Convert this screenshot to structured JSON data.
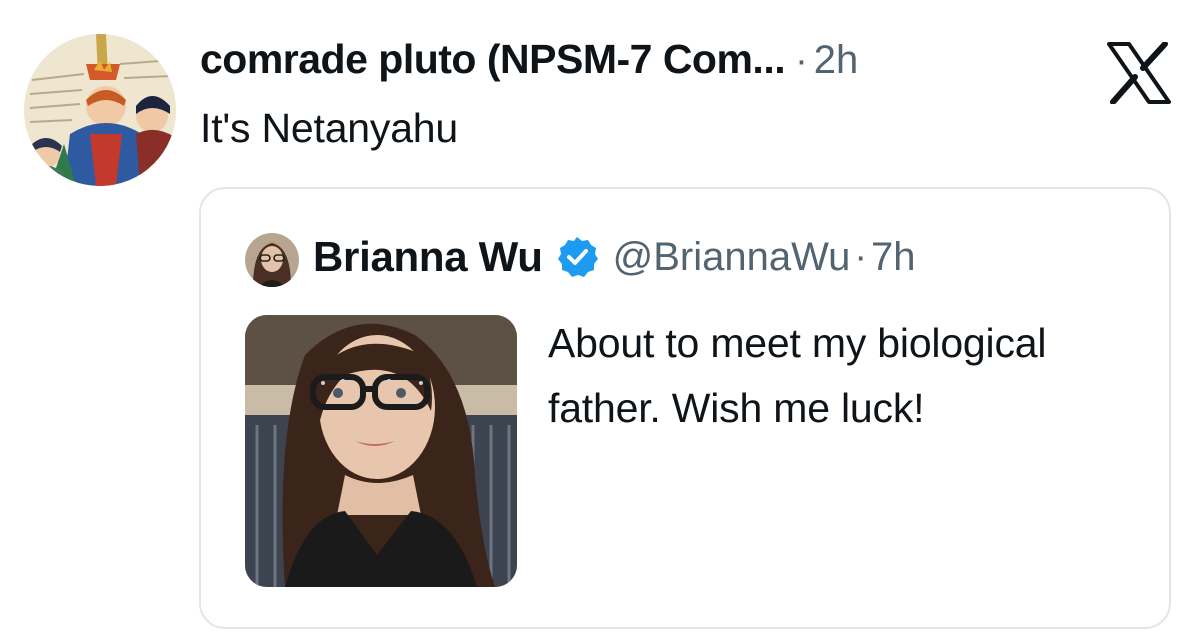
{
  "tweet": {
    "author": {
      "display_name": "comrade pluto (NPSM-7 Com...",
      "avatar_icon": "medieval-illustration-avatar"
    },
    "separator": "·",
    "time": "2h",
    "text": "It's Netanyahu",
    "brand_icon": "x-logo-icon"
  },
  "quoted_tweet": {
    "author": {
      "display_name": "Brianna Wu",
      "handle": "@BriannaWu",
      "verified": true,
      "avatar_icon": "profile-photo-avatar"
    },
    "separator": "·",
    "time": "7h",
    "text": "About to meet my biological father. Wish me luck!",
    "media": {
      "kind": "photo"
    }
  },
  "colors": {
    "text_primary": "#0f1419",
    "text_secondary": "#536471",
    "verified_blue": "#1d9bf0",
    "border": "#e1e6ea"
  }
}
